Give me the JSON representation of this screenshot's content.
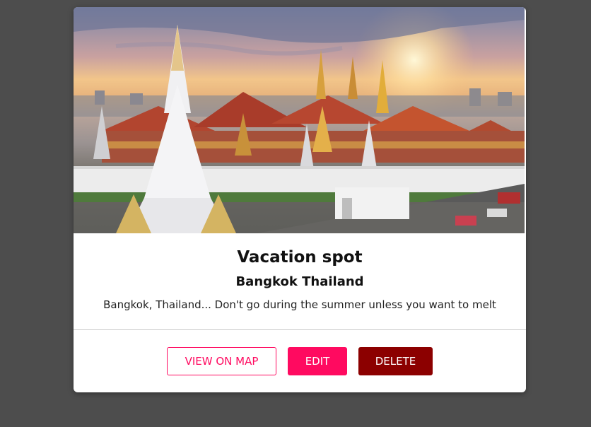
{
  "card": {
    "image_alt": "Grand Palace temple complex at sunset",
    "title": "Vacation spot",
    "subtitle": "Bangkok Thailand",
    "description": "Bangkok, Thailand... Don't go during the summer unless you want to melt"
  },
  "actions": {
    "view_on_map": "VIEW ON MAP",
    "edit": "EDIT",
    "delete": "DELETE"
  },
  "colors": {
    "page_background": "#4d4d4d",
    "accent": "#ff0a60",
    "danger": "#8c0000",
    "card_background": "#ffffff"
  }
}
